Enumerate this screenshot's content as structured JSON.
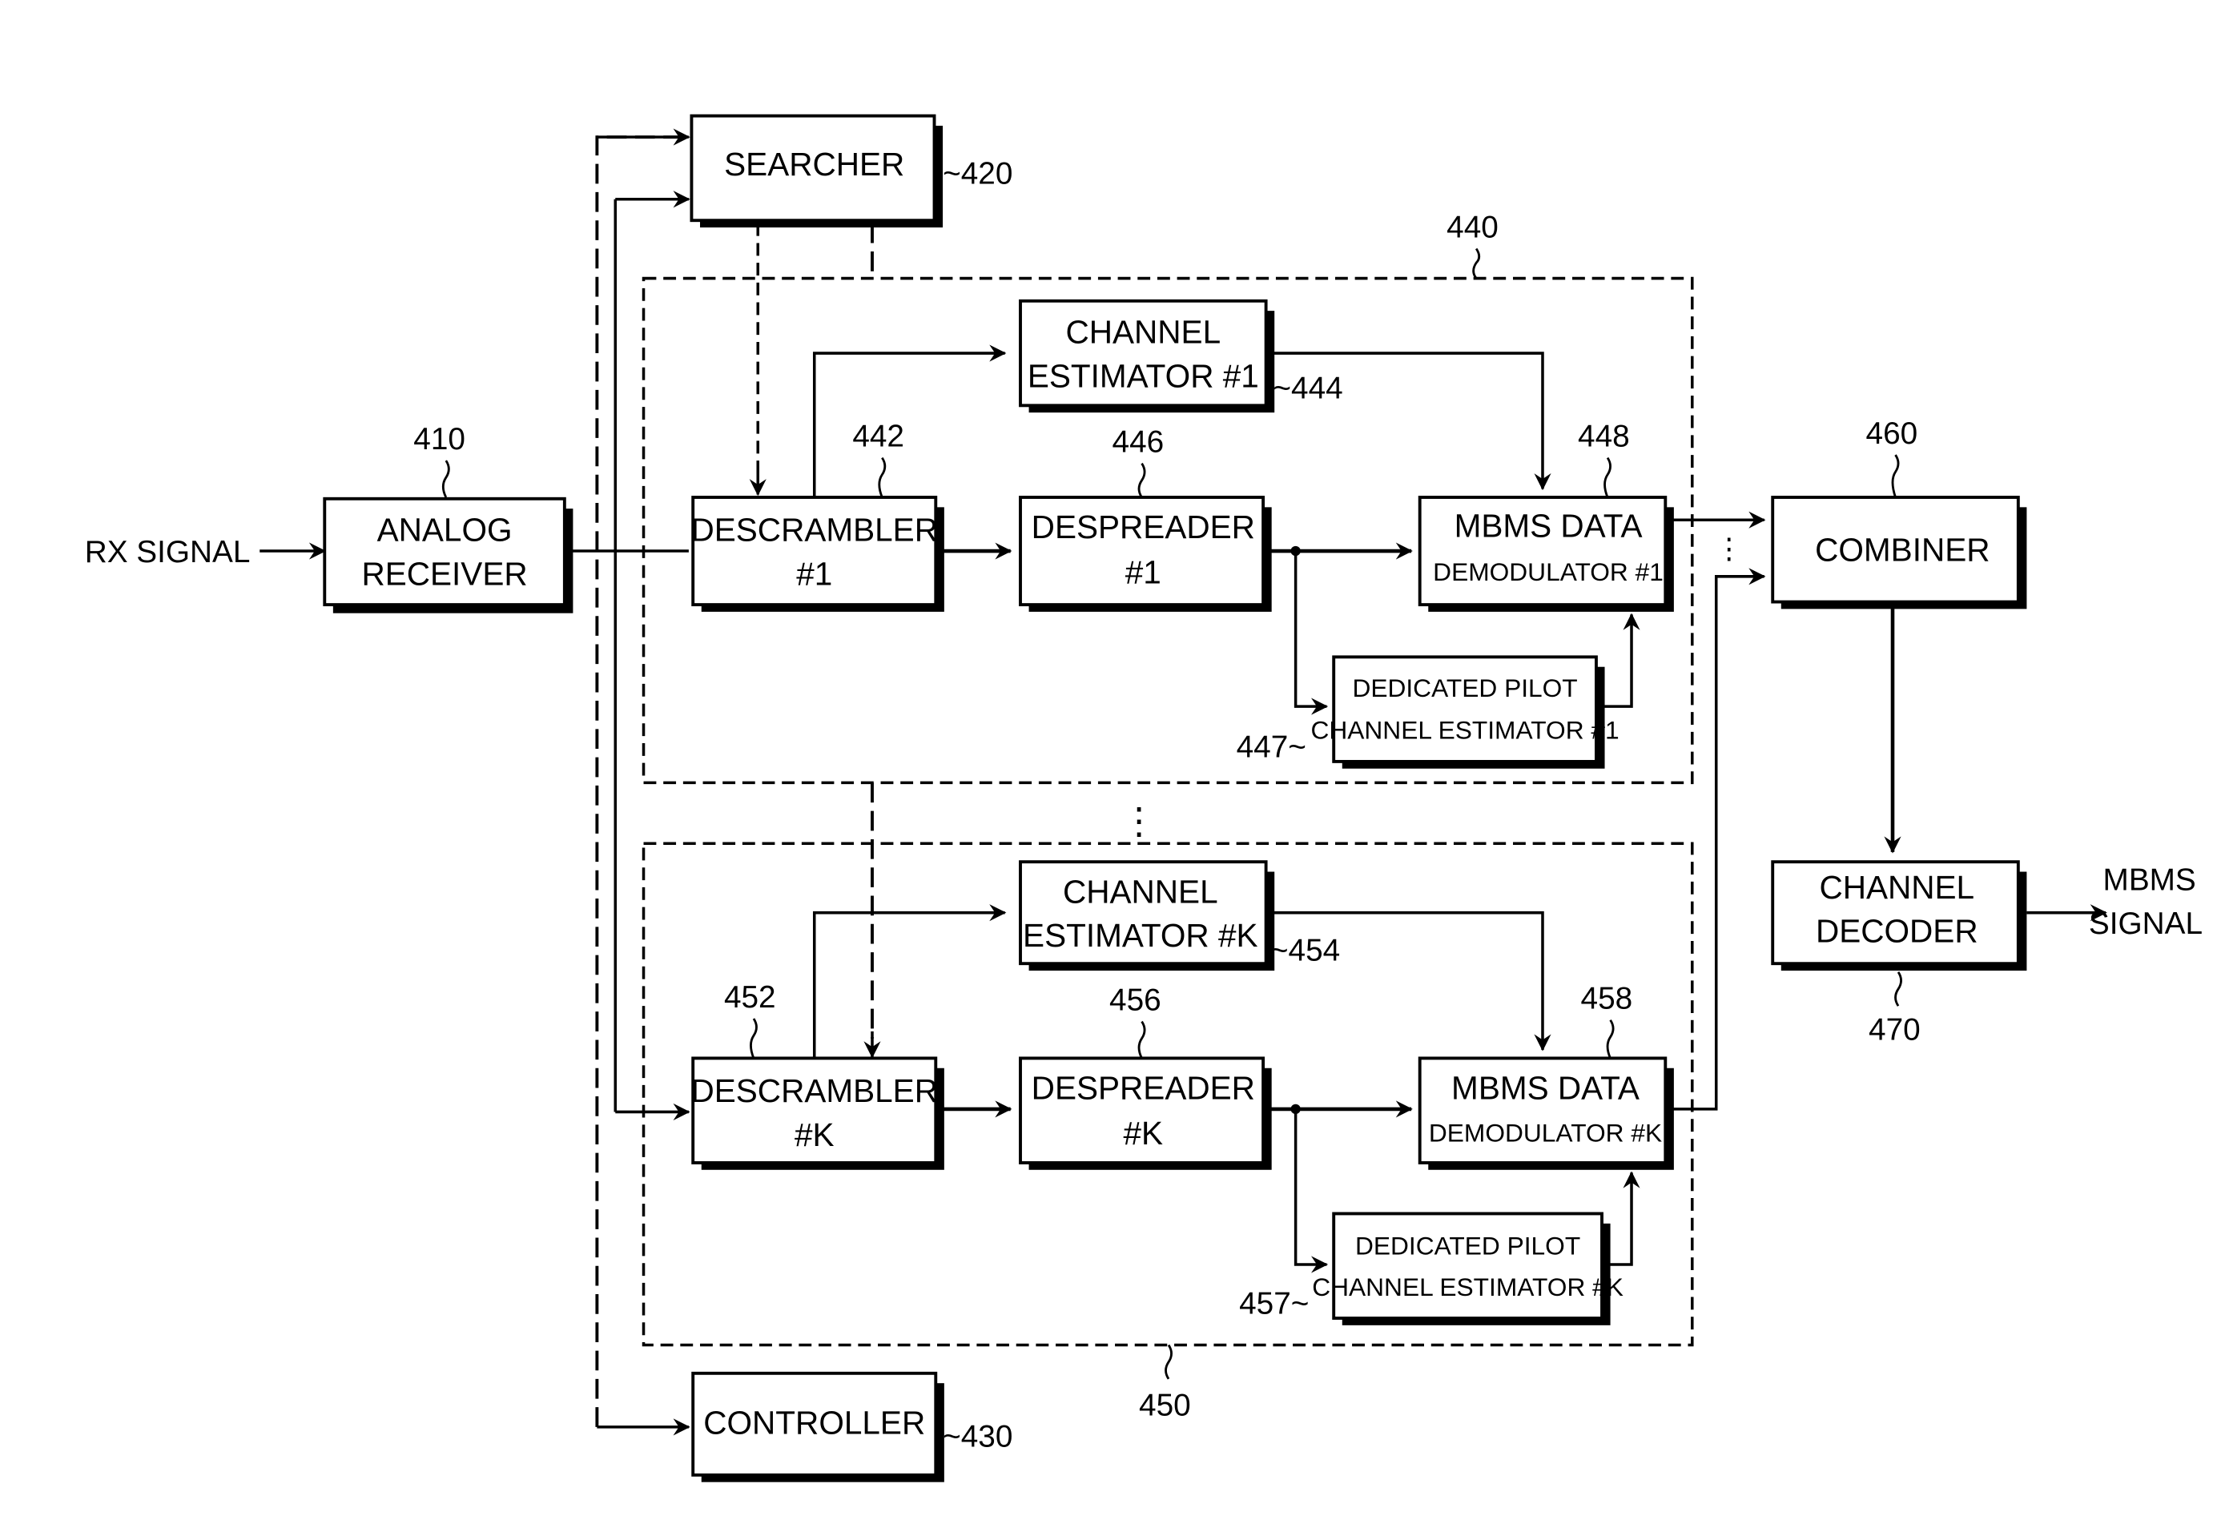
{
  "diagram": {
    "input": "RX SIGNAL",
    "output": [
      "MBMS",
      "SIGNAL"
    ],
    "blocks": {
      "analog_receiver": {
        "lines": [
          "ANALOG",
          "RECEIVER"
        ],
        "ref": "410"
      },
      "searcher": {
        "lines": [
          "SEARCHER"
        ],
        "ref": "~420"
      },
      "controller": {
        "lines": [
          "CONTROLLER"
        ],
        "ref": "~430"
      },
      "branch1_group_ref": "440",
      "branchK_group_ref": "450",
      "descrambler_1": {
        "lines": [
          "DESCRAMBLER",
          "#1"
        ],
        "ref": "442"
      },
      "channel_estimator_1": {
        "lines": [
          "CHANNEL",
          "ESTIMATOR #1"
        ],
        "ref": "~444"
      },
      "despreader_1": {
        "lines": [
          "DESPREADER",
          "#1"
        ],
        "ref": "446"
      },
      "dedicated_pilot_1": {
        "lines": [
          "DEDICATED PILOT",
          "CHANNEL ESTIMATOR #1"
        ],
        "ref": "447~"
      },
      "mbms_demod_1": {
        "lines": [
          "MBMS DATA",
          "DEMODULATOR #1"
        ],
        "ref": "448"
      },
      "descrambler_k": {
        "lines": [
          "DESCRAMBLER",
          "#K"
        ],
        "ref": "452"
      },
      "channel_estimator_k": {
        "lines": [
          "CHANNEL",
          "ESTIMATOR #K"
        ],
        "ref": "~454"
      },
      "despreader_k": {
        "lines": [
          "DESPREADER",
          "#K"
        ],
        "ref": "456"
      },
      "dedicated_pilot_k": {
        "lines": [
          "DEDICATED PILOT",
          "CHANNEL ESTIMATOR #K"
        ],
        "ref": "457~"
      },
      "mbms_demod_k": {
        "lines": [
          "MBMS DATA",
          "DEMODULATOR #K"
        ],
        "ref": "458"
      },
      "combiner": {
        "lines": [
          "COMBINER"
        ],
        "ref": "460"
      },
      "channel_decoder": {
        "lines": [
          "CHANNEL",
          "DECODER"
        ],
        "ref": "470"
      }
    },
    "ellipsis": "⋮"
  }
}
